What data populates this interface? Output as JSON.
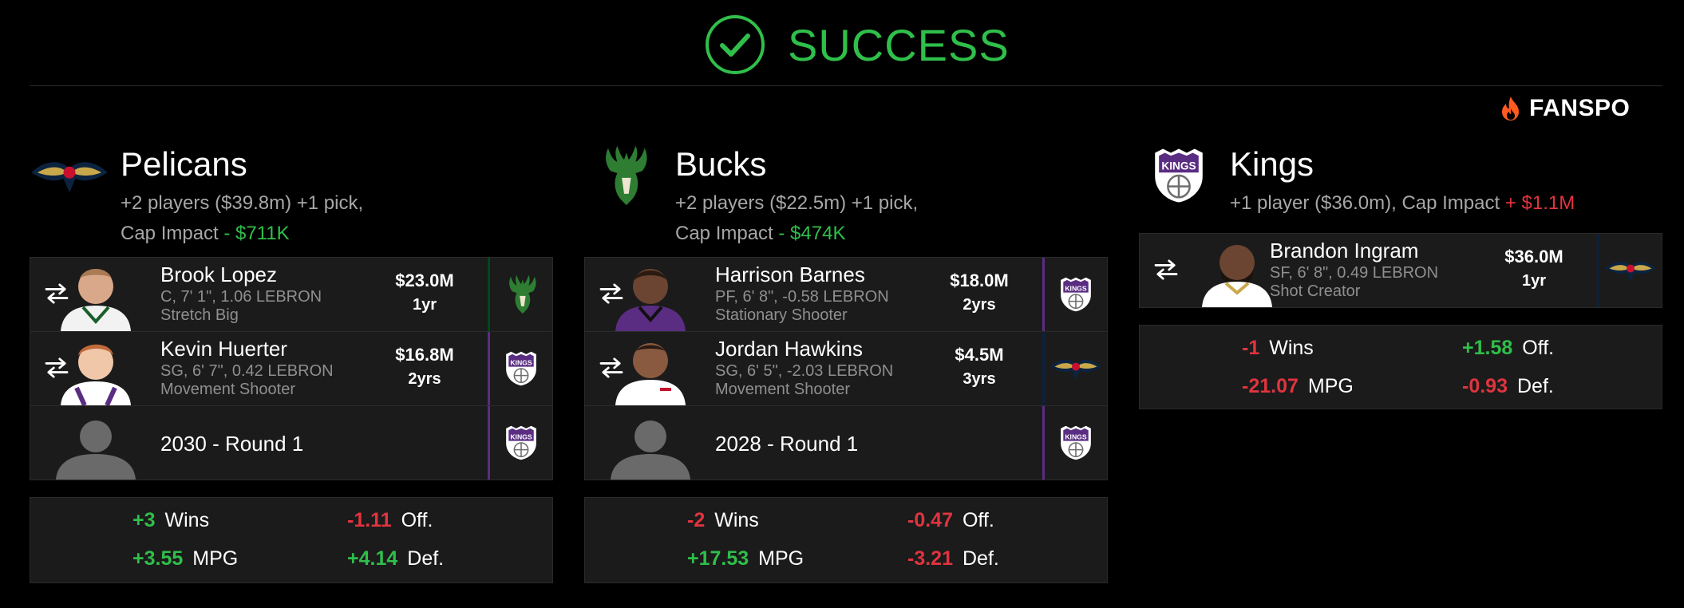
{
  "header": {
    "status": "SUCCESS",
    "brand": "FANSPO"
  },
  "colors": {
    "success": "#2fbf4a",
    "negative": "#e0343f",
    "kings": "#5a2d82",
    "bucks": "#00471b",
    "pelicans": "#0a2240",
    "brand_flame": "#ff5a1f"
  },
  "teams": [
    {
      "name": "Pelicans",
      "logo": "pelicans-logo",
      "sub_line1": "+2 players ($39.8m) +1 pick,",
      "sub_line2_label": "Cap Impact",
      "sub_line2_value": " - $711K",
      "assets": [
        {
          "name": "Brook Lopez",
          "info1": "C, 7' 1\", 1.06 LEBRON",
          "info2": "Stretch Big",
          "salary": "$23.0M",
          "years": "1yr",
          "dest": "bucks-logo"
        },
        {
          "name": "Kevin Huerter",
          "info1": "SG, 6' 7\", 0.42 LEBRON",
          "info2": "Movement Shooter",
          "salary": "$16.8M",
          "years": "2yrs",
          "dest": "kings-logo"
        },
        {
          "pick": "2030 - Round 1",
          "dest": "kings-logo"
        }
      ],
      "impact": {
        "wins_value": "+3",
        "wins_label": "Wins",
        "off_value": "-1.11",
        "off_label": "Off.",
        "mpg_value": "+3.55",
        "mpg_label": "MPG",
        "def_value": "+4.14",
        "def_label": "Def."
      }
    },
    {
      "name": "Bucks",
      "logo": "bucks-logo",
      "sub_line1": "+2 players ($22.5m) +1 pick,",
      "sub_line2_label": "Cap Impact",
      "sub_line2_value": " - $474K",
      "assets": [
        {
          "name": "Harrison Barnes",
          "info1": "PF, 6' 8\", -0.58 LEBRON",
          "info2": "Stationary Shooter",
          "salary": "$18.0M",
          "years": "2yrs",
          "dest": "kings-logo"
        },
        {
          "name": "Jordan Hawkins",
          "info1": "SG, 6' 5\", -2.03 LEBRON",
          "info2": "Movement Shooter",
          "salary": "$4.5M",
          "years": "3yrs",
          "dest": "pelicans-logo"
        },
        {
          "pick": "2028 - Round 1",
          "dest": "kings-logo"
        }
      ],
      "impact": {
        "wins_value": "-2",
        "wins_label": "Wins",
        "off_value": "-0.47",
        "off_label": "Off.",
        "mpg_value": "+17.53",
        "mpg_label": "MPG",
        "def_value": "-3.21",
        "def_label": "Def."
      }
    },
    {
      "name": "Kings",
      "logo": "kings-logo",
      "sub_line1": "+1 player ($36.0m), Cap Impact",
      "sub_line1_value": " + $1.1M",
      "assets": [
        {
          "name": "Brandon Ingram",
          "info1": "SF, 6' 8\", 0.49 LEBRON",
          "info2": "Shot Creator",
          "salary": "$36.0M",
          "years": "1yr",
          "dest": "pelicans-logo"
        }
      ],
      "impact": {
        "wins_value": "-1",
        "wins_label": "Wins",
        "off_value": "+1.58",
        "off_label": "Off.",
        "mpg_value": "-21.07",
        "mpg_label": "MPG",
        "def_value": "-0.93",
        "def_label": "Def."
      }
    }
  ]
}
